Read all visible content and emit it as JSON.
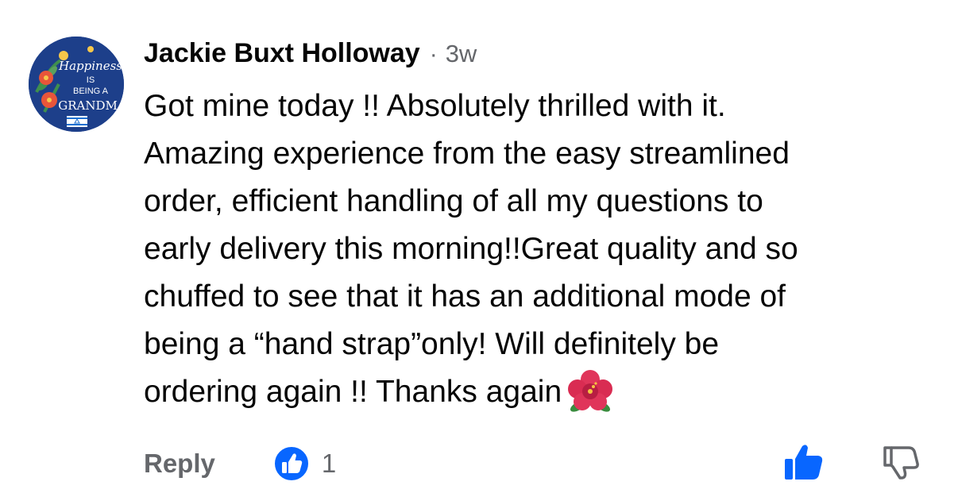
{
  "comment": {
    "author": "Jackie Buxt Holloway",
    "separator": "·",
    "time": "3w",
    "text": "Got mine today !! Absolutely thrilled with it.\nAmazing experience from the easy streamlined\norder, efficient handling of all my questions to\nearly delivery this morning!!Great quality and so\nchuffed to see that it has an additional mode of\nbeing a “hand strap”only! Will definitely be\nordering again !! Thanks again",
    "emoji": "hibiscus-emoji",
    "avatar": {
      "lines": [
        "Happiness",
        "IS",
        "BEING A",
        "GRANDMA"
      ],
      "colors": {
        "background": "#1d3f8a",
        "flower": "#e8553a",
        "leaf": "#3f8f4e",
        "text": "#ffffff"
      }
    }
  },
  "actions": {
    "reply_label": "Reply",
    "like_count": "1",
    "like_icon": "thumbs-up-icon",
    "dislike_icon": "thumbs-down-icon"
  },
  "colors": {
    "accent": "#0866ff",
    "secondary_text": "#65676b",
    "primary_text": "#050505"
  }
}
